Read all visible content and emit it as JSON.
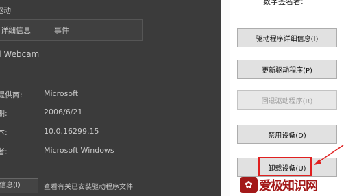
{
  "left_panel": {
    "title": "驱动",
    "tabs": [
      "详细信息",
      "事件"
    ],
    "device_name": "d Webcam",
    "properties": [
      {
        "label": "提供商:",
        "value": "Microsoft"
      },
      {
        "label": "期:",
        "value": "2006/6/21"
      },
      {
        "label": "本:",
        "value": "10.0.16299.15"
      },
      {
        "label": "者:",
        "value": "Microsoft Windows"
      }
    ],
    "bottom_button": "信息(I)",
    "bottom_link": "查看有关已安装驱动程序文件"
  },
  "right_panel": {
    "signer_label": "数字签名者:",
    "buttons": [
      {
        "label": "驱动程序详细信息(I)",
        "enabled": true
      },
      {
        "label": "更新驱动程序(P)",
        "enabled": true
      },
      {
        "label": "回退驱动程序(R)",
        "enabled": false
      },
      {
        "label": "禁用设备(D)",
        "enabled": true
      },
      {
        "label": "卸载设备(U)",
        "enabled": true
      }
    ]
  },
  "watermark": {
    "text": "爱极知识网",
    "icon": "logo-icon"
  },
  "colors": {
    "highlight": "#e02020",
    "watermark": "#a31919"
  }
}
